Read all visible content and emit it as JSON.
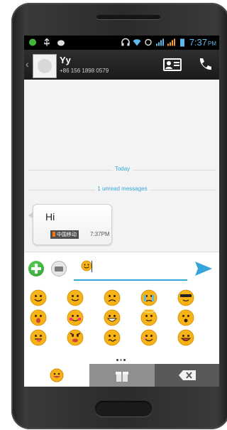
{
  "statusbar": {
    "time": "7:37",
    "ampm": "PM"
  },
  "contact": {
    "name": "Yy",
    "number": "+86 156 1898 0579"
  },
  "conversation": {
    "date_divider": "Today",
    "unread_divider": "1 unread messages",
    "messages": [
      {
        "text": "Hi",
        "carrier": "中国移动",
        "time": "7:37PM"
      }
    ]
  },
  "compose": {
    "has_emoji": true
  },
  "emoji_panel": {
    "faces": [
      "smile",
      "wink",
      "sad",
      "crying",
      "cool",
      "surprised",
      "blush",
      "grin",
      "angel",
      "shocked",
      "tongue",
      "angry",
      "nervous",
      "cheerful",
      "happy"
    ],
    "page_count": 3,
    "active_page": 2
  },
  "tabs": [
    "emoji-tab",
    "gift-tab",
    "backspace-tab"
  ],
  "colors": {
    "accent": "#35a6d9",
    "emoji_yellow": "#f6b318",
    "add_green": "#3fb83b"
  }
}
